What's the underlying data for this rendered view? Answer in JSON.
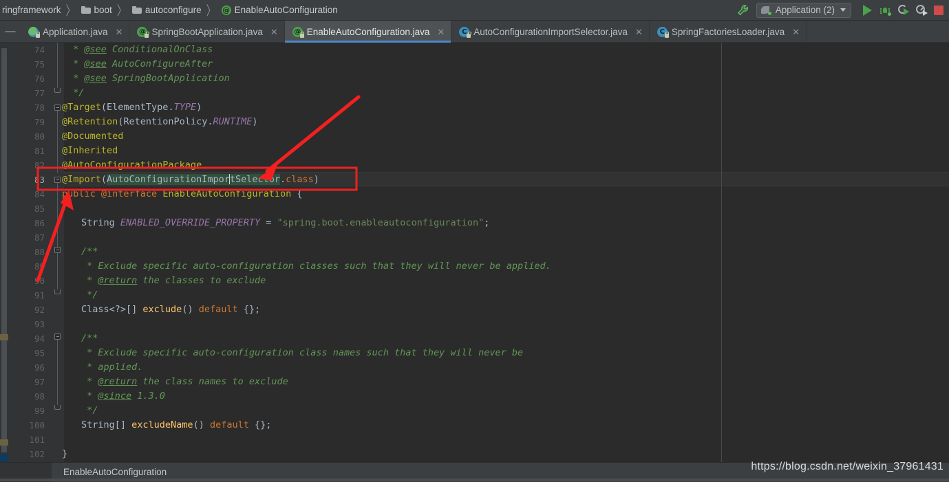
{
  "window": {
    "theme_bg": "#3c3f41",
    "editor_bg": "#2b2b2b",
    "accent": "#4a88c7"
  },
  "breadcrumb": {
    "items": [
      {
        "label": "ringframework",
        "icon": ""
      },
      {
        "label": "boot",
        "icon": "folder-icon"
      },
      {
        "label": "autoconfigure",
        "icon": "folder-icon"
      },
      {
        "label": "EnableAutoConfiguration",
        "icon": "annotation-icon"
      }
    ],
    "separator": "〉"
  },
  "toolbar": {
    "wrench_icon": "wrench-icon",
    "run_config": {
      "label": "Application (2)",
      "icon": "spring-boot-run-icon",
      "caret": "chevron-down-icon"
    },
    "buttons": [
      {
        "name": "run-button",
        "icon": "run-triangle-icon",
        "color": "#49a349"
      },
      {
        "name": "debug-button",
        "icon": "bug-icon",
        "color": "#49a349"
      },
      {
        "name": "run-with-coverage-button",
        "icon": "coverage-icon",
        "color": "#b0b4b6"
      },
      {
        "name": "profile-button",
        "icon": "profiler-icon",
        "color": "#b0b4b6"
      },
      {
        "name": "stop-button",
        "icon": "stop-square-icon",
        "color": "#cf4a4a"
      }
    ]
  },
  "tabs": {
    "collapse_glyph": "—",
    "close_glyph": "✕",
    "items": [
      {
        "label": "Application.java",
        "icon": "spring-class-icon",
        "active": false
      },
      {
        "label": "SpringBootApplication.java",
        "icon": "annotation-icon",
        "active": false
      },
      {
        "label": "EnableAutoConfiguration.java",
        "icon": "annotation-icon",
        "active": true
      },
      {
        "label": "AutoConfigurationImportSelector.java",
        "icon": "class-icon",
        "active": false
      },
      {
        "label": "SpringFactoriesLoader.java",
        "icon": "class-icon",
        "active": false
      }
    ]
  },
  "editor": {
    "first_line": 74,
    "current_line": 83,
    "selection_text": "AutoConfigurationImportSelector",
    "lines": [
      {
        "n": 74,
        "indent": 1,
        "segments": [
          {
            "t": " * ",
            "c": "cmt"
          },
          {
            "t": "@see",
            "c": "cmtt"
          },
          {
            "t": " ConditionalOnClass",
            "c": "cmt"
          }
        ]
      },
      {
        "n": 75,
        "indent": 1,
        "segments": [
          {
            "t": " * ",
            "c": "cmt"
          },
          {
            "t": "@see",
            "c": "cmtt"
          },
          {
            "t": " AutoConfigureAfter",
            "c": "cmt"
          }
        ]
      },
      {
        "n": 76,
        "indent": 1,
        "segments": [
          {
            "t": " * ",
            "c": "cmt"
          },
          {
            "t": "@see",
            "c": "cmtt"
          },
          {
            "t": " SpringBootApplication",
            "c": "cmt"
          }
        ]
      },
      {
        "n": 77,
        "indent": 1,
        "segments": [
          {
            "t": " */",
            "c": "cmt"
          }
        ]
      },
      {
        "n": 78,
        "indent": 0,
        "segments": [
          {
            "t": "@Target",
            "c": "ann"
          },
          {
            "t": "(ElementType.",
            "c": "punc"
          },
          {
            "t": "TYPE",
            "c": "stat"
          },
          {
            "t": ")",
            "c": "punc"
          }
        ]
      },
      {
        "n": 79,
        "indent": 0,
        "segments": [
          {
            "t": "@Retention",
            "c": "ann"
          },
          {
            "t": "(RetentionPolicy.",
            "c": "punc"
          },
          {
            "t": "RUNTIME",
            "c": "stat"
          },
          {
            "t": ")",
            "c": "punc"
          }
        ]
      },
      {
        "n": 80,
        "indent": 0,
        "segments": [
          {
            "t": "@Documented",
            "c": "ann"
          }
        ]
      },
      {
        "n": 81,
        "indent": 0,
        "segments": [
          {
            "t": "@Inherited",
            "c": "ann"
          }
        ]
      },
      {
        "n": 82,
        "indent": 0,
        "segments": [
          {
            "t": "@AutoConfigurationPackage",
            "c": "ann"
          }
        ]
      },
      {
        "n": 83,
        "indent": 0,
        "segments": [
          {
            "t": "@Import",
            "c": "ann"
          },
          {
            "t": "(",
            "c": "punc"
          },
          {
            "t": "AutoConfigurationImpor",
            "c": "sel"
          },
          {
            "t": "|",
            "c": "caret"
          },
          {
            "t": "tSelector",
            "c": "sel"
          },
          {
            "t": ".",
            "c": "punc"
          },
          {
            "t": "class",
            "c": "kw"
          },
          {
            "t": ")",
            "c": "punc"
          }
        ]
      },
      {
        "n": 84,
        "indent": 0,
        "segments": [
          {
            "t": "public ",
            "c": "kw"
          },
          {
            "t": "@interface ",
            "c": "kw"
          },
          {
            "t": "EnableAutoConfiguration",
            "c": "ann"
          },
          {
            "t": " {",
            "c": "punc"
          }
        ]
      },
      {
        "n": 85,
        "indent": 0,
        "segments": []
      },
      {
        "n": 86,
        "indent": 2,
        "segments": [
          {
            "t": "String ",
            "c": "ident"
          },
          {
            "t": "ENABLED_OVERRIDE_PROPERTY",
            "c": "cons"
          },
          {
            "t": " = ",
            "c": "punc"
          },
          {
            "t": "\"spring.boot.enableautoconfiguration\"",
            "c": "str"
          },
          {
            "t": ";",
            "c": "punc"
          }
        ]
      },
      {
        "n": 87,
        "indent": 0,
        "segments": []
      },
      {
        "n": 88,
        "indent": 2,
        "segments": [
          {
            "t": "/**",
            "c": "cmt"
          }
        ]
      },
      {
        "n": 89,
        "indent": 2,
        "segments": [
          {
            "t": " * Exclude specific auto-configuration classes such that they will never be applied.",
            "c": "cmt"
          }
        ]
      },
      {
        "n": 90,
        "indent": 2,
        "segments": [
          {
            "t": " * ",
            "c": "cmt"
          },
          {
            "t": "@return",
            "c": "cmtt"
          },
          {
            "t": " the classes to exclude",
            "c": "cmt"
          }
        ]
      },
      {
        "n": 91,
        "indent": 2,
        "segments": [
          {
            "t": " */",
            "c": "cmt"
          }
        ]
      },
      {
        "n": 92,
        "indent": 2,
        "segments": [
          {
            "t": "Class<?>[] ",
            "c": "ident"
          },
          {
            "t": "exclude",
            "c": "meth"
          },
          {
            "t": "() ",
            "c": "punc"
          },
          {
            "t": "default ",
            "c": "kw"
          },
          {
            "t": "{};",
            "c": "punc"
          }
        ]
      },
      {
        "n": 93,
        "indent": 0,
        "segments": []
      },
      {
        "n": 94,
        "indent": 2,
        "segments": [
          {
            "t": "/**",
            "c": "cmt"
          }
        ]
      },
      {
        "n": 95,
        "indent": 2,
        "segments": [
          {
            "t": " * Exclude specific auto-configuration class names such that they will never be",
            "c": "cmt"
          }
        ]
      },
      {
        "n": 96,
        "indent": 2,
        "segments": [
          {
            "t": " * applied.",
            "c": "cmt"
          }
        ]
      },
      {
        "n": 97,
        "indent": 2,
        "segments": [
          {
            "t": " * ",
            "c": "cmt"
          },
          {
            "t": "@return",
            "c": "cmtt"
          },
          {
            "t": " the class names to exclude",
            "c": "cmt"
          }
        ]
      },
      {
        "n": 98,
        "indent": 2,
        "segments": [
          {
            "t": " * ",
            "c": "cmt"
          },
          {
            "t": "@since",
            "c": "cmtt"
          },
          {
            "t": " 1.3.0",
            "c": "cmt"
          }
        ]
      },
      {
        "n": 99,
        "indent": 2,
        "segments": [
          {
            "t": " */",
            "c": "cmt"
          }
        ]
      },
      {
        "n": 100,
        "indent": 2,
        "segments": [
          {
            "t": "String[] ",
            "c": "ident"
          },
          {
            "t": "excludeName",
            "c": "meth"
          },
          {
            "t": "() ",
            "c": "punc"
          },
          {
            "t": "default ",
            "c": "kw"
          },
          {
            "t": "{};",
            "c": "punc"
          }
        ]
      },
      {
        "n": 101,
        "indent": 0,
        "segments": []
      },
      {
        "n": 102,
        "indent": 0,
        "segments": [
          {
            "t": "}",
            "c": "punc"
          }
        ]
      }
    ]
  },
  "annotations": {
    "highlight_color": "#f02020",
    "box_label": "import-selector-highlight-box",
    "arrow_1": "arrow-to-import-selector",
    "arrow_2": "arrow-to-public-keyword"
  },
  "bottom_breadcrumb": {
    "label": "EnableAutoConfiguration"
  },
  "watermark": {
    "text": "https://blog.csdn.net/weixin_37961431"
  }
}
